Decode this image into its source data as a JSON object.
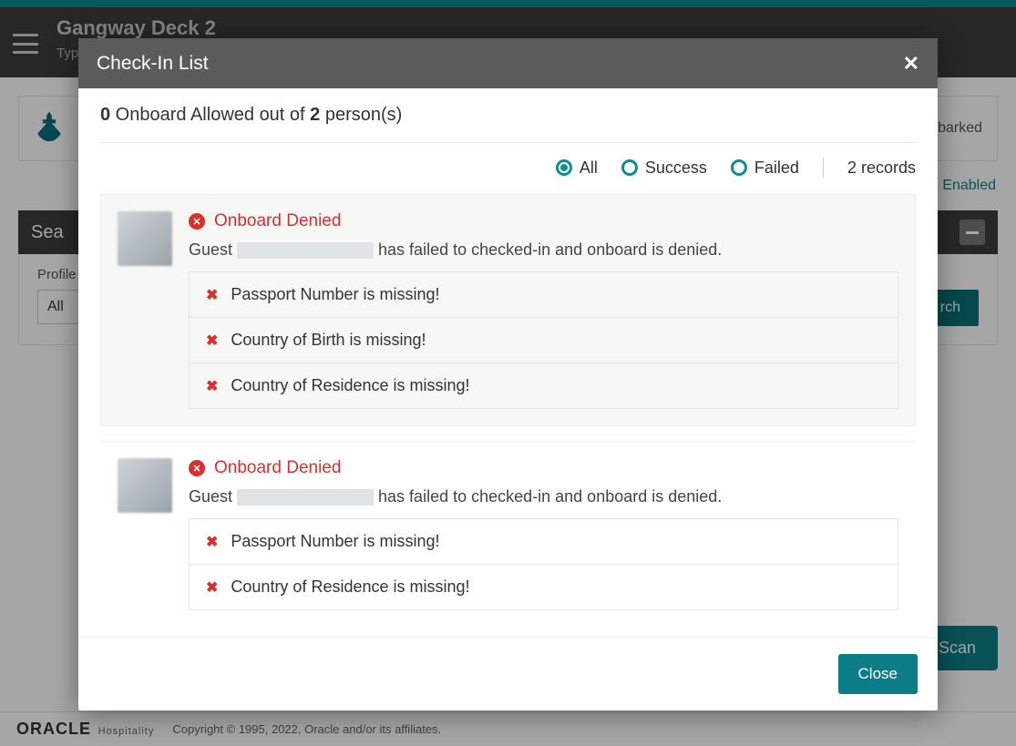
{
  "app": {
    "title": "Gangway Deck 2",
    "subtitle_prefix": "Typ"
  },
  "background": {
    "top_card_right_text": "barked",
    "sound_link": "Enabled",
    "search_header": "Sea",
    "filter_label": "Profile",
    "filter_select_value": "All",
    "search_btn_suffix": "rch",
    "scan_btn": "Scan"
  },
  "modal": {
    "title": "Check-In List",
    "summary": {
      "allowed_count": "0",
      "mid_text": " Onboard Allowed out of ",
      "total_count": "2",
      "suffix": " person(s)"
    },
    "filters": {
      "all": "All",
      "success": "Success",
      "failed": "Failed",
      "record_count": "2 records"
    },
    "entries": [
      {
        "status": "Onboard Denied",
        "guest_prefix": "Guest ",
        "guest_suffix": " has failed to checked-in and onboard is denied.",
        "errors": [
          "Passport Number is missing!",
          "Country of Birth is missing!",
          "Country of Residence is missing!"
        ]
      },
      {
        "status": "Onboard Denied",
        "guest_prefix": "Guest ",
        "guest_suffix": " has failed to checked-in and onboard is denied.",
        "errors": [
          "Passport Number is missing!",
          "Country of Residence is missing!"
        ]
      }
    ],
    "close_btn": "Close"
  },
  "footer": {
    "brand": "ORACLE",
    "brand_sub": "Hospitality",
    "copyright": "Copyright © 1995, 2022, Oracle and/or its affiliates."
  }
}
